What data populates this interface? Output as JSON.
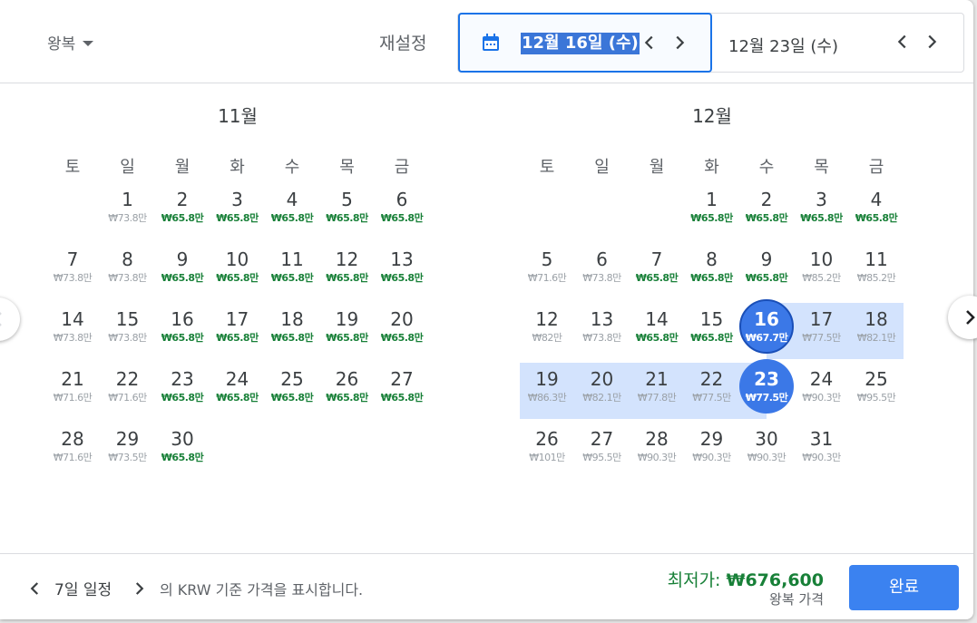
{
  "header": {
    "trip_type": "왕복",
    "reset": "재설정",
    "departure": "12월 16일 (수)",
    "return": "12월 23일 (수)"
  },
  "weekdays": [
    "토",
    "일",
    "월",
    "화",
    "수",
    "목",
    "금"
  ],
  "months": [
    {
      "title": "11월",
      "offset": 1,
      "days": [
        {
          "n": "1",
          "p": "₩73.8만",
          "low": false
        },
        {
          "n": "2",
          "p": "₩65.8만",
          "low": true
        },
        {
          "n": "3",
          "p": "₩65.8만",
          "low": true
        },
        {
          "n": "4",
          "p": "₩65.8만",
          "low": true
        },
        {
          "n": "5",
          "p": "₩65.8만",
          "low": true
        },
        {
          "n": "6",
          "p": "₩65.8만",
          "low": true
        },
        {
          "n": "7",
          "p": "₩73.8만",
          "low": false
        },
        {
          "n": "8",
          "p": "₩73.8만",
          "low": false
        },
        {
          "n": "9",
          "p": "₩65.8만",
          "low": true
        },
        {
          "n": "10",
          "p": "₩65.8만",
          "low": true
        },
        {
          "n": "11",
          "p": "₩65.8만",
          "low": true
        },
        {
          "n": "12",
          "p": "₩65.8만",
          "low": true
        },
        {
          "n": "13",
          "p": "₩65.8만",
          "low": true
        },
        {
          "n": "14",
          "p": "₩73.8만",
          "low": false
        },
        {
          "n": "15",
          "p": "₩73.8만",
          "low": false
        },
        {
          "n": "16",
          "p": "₩65.8만",
          "low": true
        },
        {
          "n": "17",
          "p": "₩65.8만",
          "low": true
        },
        {
          "n": "18",
          "p": "₩65.8만",
          "low": true
        },
        {
          "n": "19",
          "p": "₩65.8만",
          "low": true
        },
        {
          "n": "20",
          "p": "₩65.8만",
          "low": true
        },
        {
          "n": "21",
          "p": "₩71.6만",
          "low": false
        },
        {
          "n": "22",
          "p": "₩71.6만",
          "low": false
        },
        {
          "n": "23",
          "p": "₩65.8만",
          "low": true
        },
        {
          "n": "24",
          "p": "₩65.8만",
          "low": true
        },
        {
          "n": "25",
          "p": "₩65.8만",
          "low": true
        },
        {
          "n": "26",
          "p": "₩65.8만",
          "low": true
        },
        {
          "n": "27",
          "p": "₩65.8만",
          "low": true
        },
        {
          "n": "28",
          "p": "₩71.6만",
          "low": false
        },
        {
          "n": "29",
          "p": "₩73.5만",
          "low": false
        },
        {
          "n": "30",
          "p": "₩65.8만",
          "low": true
        }
      ]
    },
    {
      "title": "12월",
      "offset": 3,
      "days": [
        {
          "n": "1",
          "p": "₩65.8만",
          "low": true
        },
        {
          "n": "2",
          "p": "₩65.8만",
          "low": true
        },
        {
          "n": "3",
          "p": "₩65.8만",
          "low": true
        },
        {
          "n": "4",
          "p": "₩65.8만",
          "low": true
        },
        {
          "n": "5",
          "p": "₩71.6만",
          "low": false
        },
        {
          "n": "6",
          "p": "₩73.8만",
          "low": false
        },
        {
          "n": "7",
          "p": "₩65.8만",
          "low": true
        },
        {
          "n": "8",
          "p": "₩65.8만",
          "low": true
        },
        {
          "n": "9",
          "p": "₩65.8만",
          "low": true
        },
        {
          "n": "10",
          "p": "₩85.2만",
          "low": false
        },
        {
          "n": "11",
          "p": "₩85.2만",
          "low": false
        },
        {
          "n": "12",
          "p": "₩82만",
          "low": false
        },
        {
          "n": "13",
          "p": "₩73.8만",
          "low": false
        },
        {
          "n": "14",
          "p": "₩65.8만",
          "low": true
        },
        {
          "n": "15",
          "p": "₩65.8만",
          "low": true
        },
        {
          "n": "16",
          "p": "₩67.7만",
          "low": false,
          "sel": "dep"
        },
        {
          "n": "17",
          "p": "₩77.5만",
          "low": false
        },
        {
          "n": "18",
          "p": "₩82.1만",
          "low": false
        },
        {
          "n": "19",
          "p": "₩86.3만",
          "low": false
        },
        {
          "n": "20",
          "p": "₩82.1만",
          "low": false
        },
        {
          "n": "21",
          "p": "₩77.8만",
          "low": false
        },
        {
          "n": "22",
          "p": "₩77.5만",
          "low": false
        },
        {
          "n": "23",
          "p": "₩77.5만",
          "low": false,
          "sel": "ret"
        },
        {
          "n": "24",
          "p": "₩90.3만",
          "low": false
        },
        {
          "n": "25",
          "p": "₩95.5만",
          "low": false
        },
        {
          "n": "26",
          "p": "₩101만",
          "low": false
        },
        {
          "n": "27",
          "p": "₩95.5만",
          "low": false
        },
        {
          "n": "28",
          "p": "₩90.3만",
          "low": false
        },
        {
          "n": "29",
          "p": "₩90.3만",
          "low": false
        },
        {
          "n": "30",
          "p": "₩90.3만",
          "low": false
        },
        {
          "n": "31",
          "p": "₩90.3만",
          "low": false
        }
      ]
    }
  ],
  "footer": {
    "duration": "7일 일정",
    "text": "의 KRW 기준 가격을 표시합니다.",
    "lowest_label": "최저가: ",
    "lowest_value": "₩676,600",
    "lowest_sub": "왕복 가격",
    "done": "완료"
  },
  "colors": {
    "accent": "#1a73e8",
    "low_price": "#188038",
    "range": "#d3e3fd"
  }
}
